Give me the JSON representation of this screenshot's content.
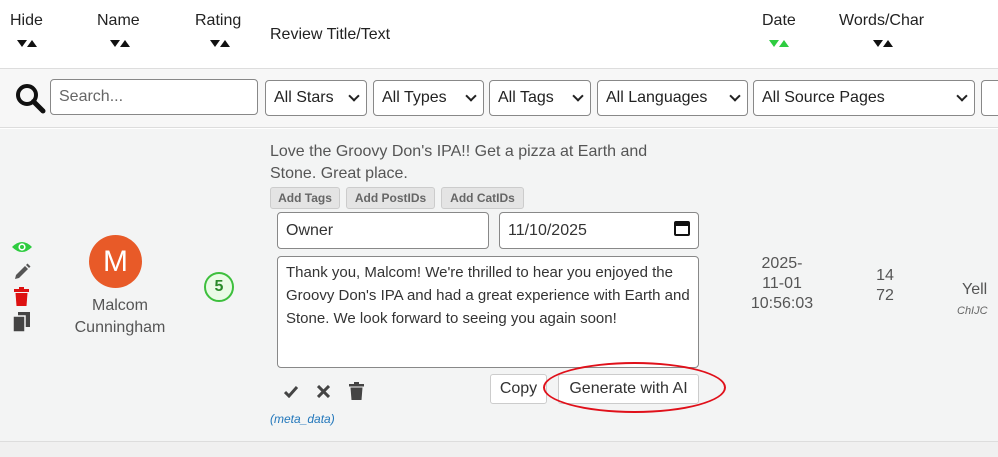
{
  "header": {
    "hide": "Hide",
    "name": "Name",
    "rating": "Rating",
    "review_title": "Review Title/Text",
    "date": "Date",
    "words_char": "Words/Char"
  },
  "filters": {
    "search_placeholder": "Search...",
    "stars": "All Stars",
    "types": "All Types",
    "tags": "All Tags",
    "languages": "All Languages",
    "source_pages": "All Source Pages"
  },
  "review": {
    "avatar_letter": "M",
    "name_line1": "Malcom",
    "name_line2": "Cunningham",
    "rating": "5",
    "text": "Love the Groovy Don's IPA!! Get a pizza at Earth and Stone. Great place.",
    "tags": {
      "add_tags": "Add Tags",
      "add_postids": "Add PostIDs",
      "add_catids": "Add CatIDs"
    },
    "owner_value": "Owner",
    "date_value": "11/10/2025",
    "reply_text": "Thank you, Malcom! We're thrilled to hear you enjoyed the Groovy Don's IPA and had a great experience with Earth and Stone. We look forward to seeing you again soon!",
    "copy_label": "Copy",
    "generate_label": "Generate with AI",
    "meta_label": "(meta_data)",
    "date_line1": "2025-",
    "date_line2": "11-01",
    "date_line3": "10:56:03",
    "words": "14",
    "chars": "72",
    "source_partial": "Yell",
    "source_id_partial": "ChIJC"
  },
  "colors": {
    "avatar": "#e85a28",
    "rating_green": "#3dbf3d",
    "eye_green": "#2ecc40",
    "trash_red": "#dd1111",
    "highlight_red": "#e0101a"
  }
}
